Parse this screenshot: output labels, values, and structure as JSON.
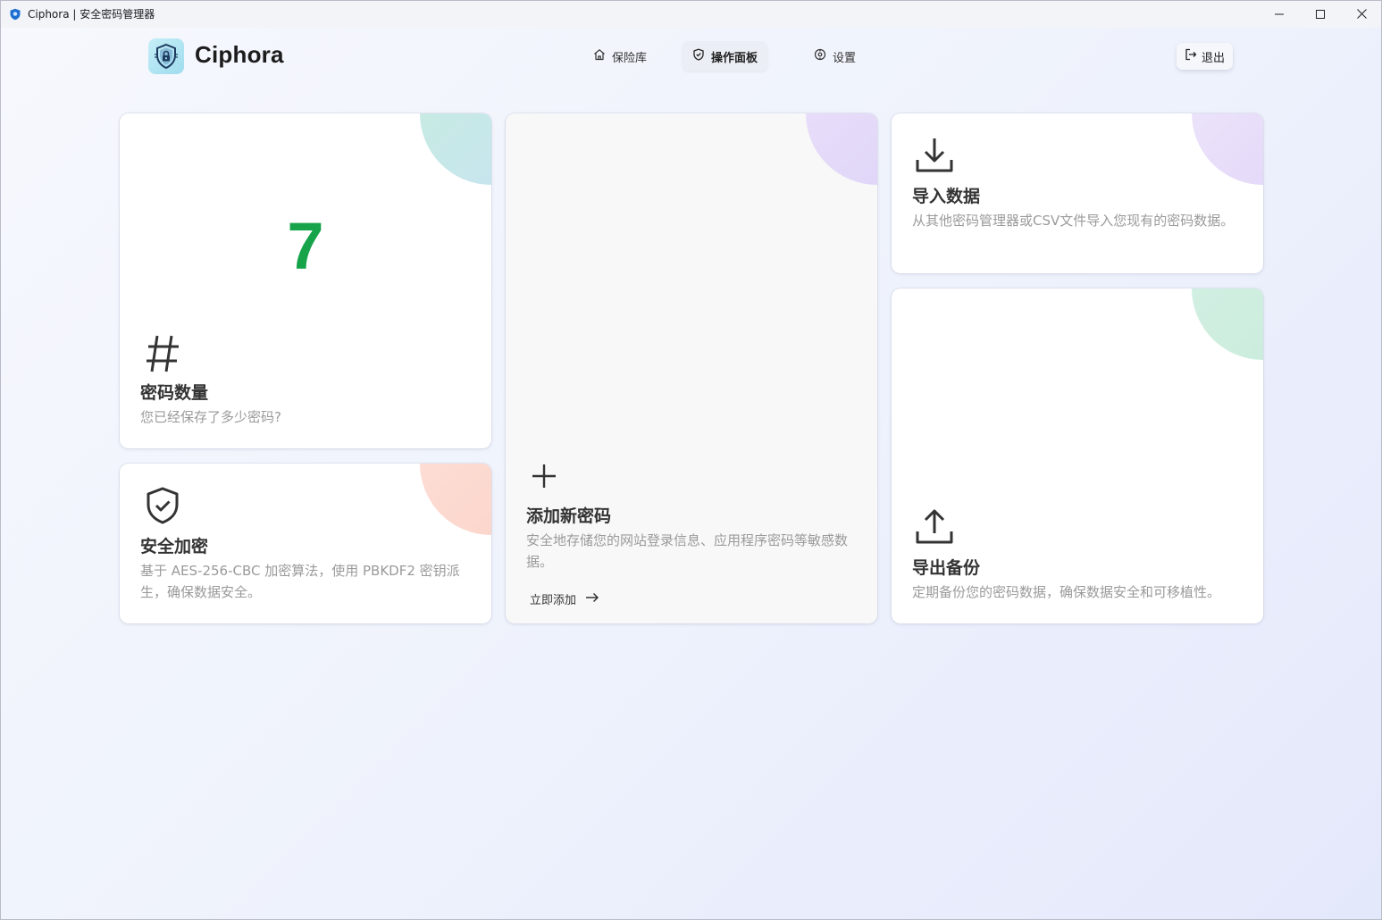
{
  "window": {
    "title": "Ciphora | 安全密码管理器",
    "app_icon": "shield-icon"
  },
  "header": {
    "brand": "Ciphora",
    "logo_icon": "shield-lock-icon",
    "nav": [
      {
        "label": "保险库",
        "icon": "home-icon",
        "active": false
      },
      {
        "label": "操作面板",
        "icon": "shield-check-icon",
        "active": true
      },
      {
        "label": "设置",
        "icon": "settings-icon",
        "active": false
      }
    ],
    "logout_label": "退出",
    "logout_icon": "logout-icon"
  },
  "cards": {
    "count": {
      "value": "7",
      "icon": "hash-icon",
      "title": "密码数量",
      "desc": "您已经保存了多少密码?",
      "value_color": "#16a34a"
    },
    "encryption": {
      "icon": "shield-check-icon",
      "title": "安全加密",
      "desc": "基于 AES-256-CBC 加密算法，使用 PBKDF2 密钥派生，确保数据安全。"
    },
    "add": {
      "icon": "plus-icon",
      "title": "添加新密码",
      "desc": "安全地存储您的网站登录信息、应用程序密码等敏感数据。",
      "link_label": "立即添加",
      "link_icon": "arrow-right-icon"
    },
    "import": {
      "icon": "download-icon",
      "title": "导入数据",
      "desc": "从其他密码管理器或CSV文件导入您现有的密码数据。"
    },
    "export": {
      "icon": "upload-icon",
      "title": "导出备份",
      "desc": "定期备份您的密码数据，确保数据安全和可移植性。"
    }
  }
}
